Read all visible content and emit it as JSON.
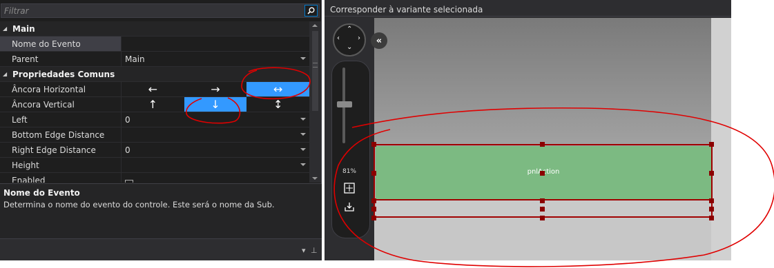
{
  "filter": {
    "placeholder": "Filtrar"
  },
  "grid": {
    "cat_main": "Main",
    "nome_evento_label": "Nome do Evento",
    "parent_label": "Parent",
    "parent_value": "Main",
    "cat_comuns": "Propriedades Comuns",
    "ancora_h_label": "Âncora Horizontal",
    "ancora_v_label": "Âncora Vertical",
    "left_label": "Left",
    "left_value": "0",
    "bottom_label": "Bottom Edge Distance",
    "right_label": "Right Edge Distance",
    "right_value": "0",
    "height_label": "Height",
    "enabled_label": "Enabled"
  },
  "anchors": {
    "h_left": "←",
    "h_right": "→",
    "h_both": "↔",
    "v_top": "↑",
    "v_bottom": "↓",
    "v_both": "↕"
  },
  "description": {
    "title": "Nome do Evento",
    "text": "Determina o nome do evento do controle. Este será o nome da Sub."
  },
  "designer": {
    "title": "Corresponder à variante selecionada",
    "zoom": "81%",
    "panel_label": "pnlAction",
    "strip_label": "· ·"
  },
  "colors": {
    "selected_anchor": "#3399ff",
    "panel_green": "#7cba82",
    "annotation_red": "#e00000"
  },
  "icons": {
    "search": "search-icon",
    "collapse": "double-chevron-left-icon",
    "fit": "fit-to-screen-icon",
    "export": "download-icon",
    "pin": "pin-icon"
  }
}
